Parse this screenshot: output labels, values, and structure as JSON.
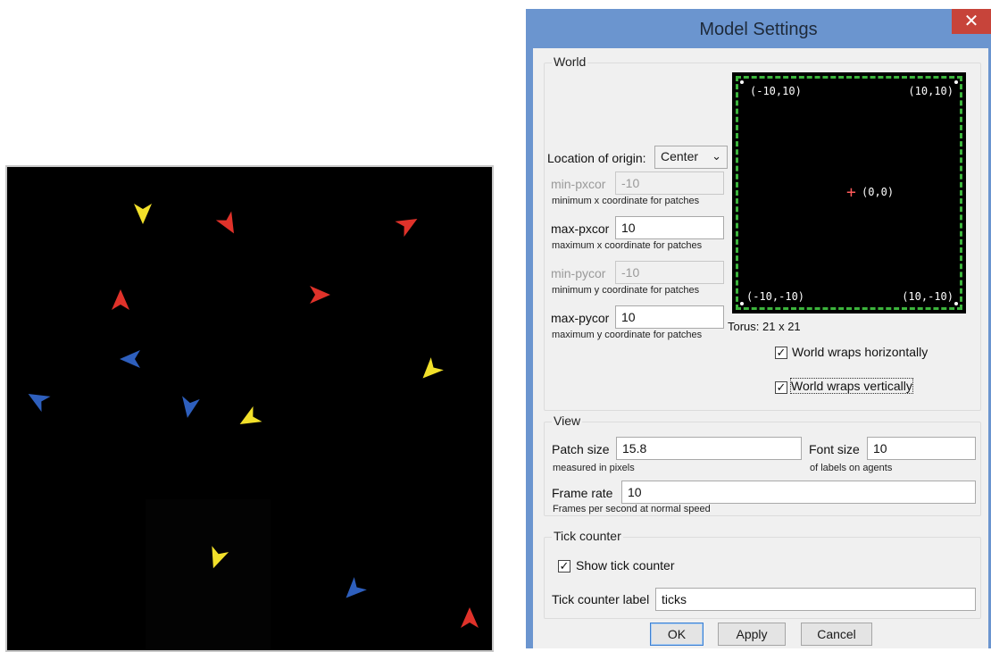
{
  "view": {
    "turtles": [
      {
        "color": "#f2e02a",
        "heading": 180
      },
      {
        "color": "#e0322a",
        "heading": 150
      },
      {
        "color": "#e0322a",
        "heading": 60
      },
      {
        "color": "#e0322a",
        "heading": 0
      },
      {
        "color": "#e0322a",
        "heading": 90
      },
      {
        "color": "#2e5fbd",
        "heading": 270
      },
      {
        "color": "#f2e02a",
        "heading": 225
      },
      {
        "color": "#2e5fbd",
        "heading": 300
      },
      {
        "color": "#2e5fbd",
        "heading": 190
      },
      {
        "color": "#f2e02a",
        "heading": 240
      },
      {
        "color": "#f2e02a",
        "heading": 200
      },
      {
        "color": "#2e5fbd",
        "heading": 225
      },
      {
        "color": "#e0322a",
        "heading": 0
      }
    ]
  },
  "dialog": {
    "title": "Model Settings",
    "close_glyph": "✕",
    "world": {
      "legend": "World",
      "origin_label": "Location of origin:",
      "origin_value": "Center",
      "min_pxcor_label": "min-pxcor",
      "min_pxcor_value": "-10",
      "min_pxcor_hint": "minimum x coordinate for patches",
      "max_pxcor_label": "max-pxcor",
      "max_pxcor_value": "10",
      "max_pxcor_hint": "maximum x coordinate for patches",
      "min_pycor_label": "min-pycor",
      "min_pycor_value": "-10",
      "min_pycor_hint": "minimum y coordinate for patches",
      "max_pycor_label": "max-pycor",
      "max_pycor_value": "10",
      "max_pycor_hint": "maximum y coordinate for patches",
      "preview": {
        "top_left": "(-10,10)",
        "top_right": "(10,10)",
        "center": "(0,0)",
        "bottom_left": "(-10,-10)",
        "bottom_right": "(10,-10)"
      },
      "torus_label": "Torus: 21 x 21",
      "wrap_h_label": "World wraps horizontally",
      "wrap_h_checked": true,
      "wrap_v_label": "World wraps vertically",
      "wrap_v_checked": true
    },
    "view": {
      "legend": "View",
      "patch_size_label": "Patch size",
      "patch_size_value": "15.8",
      "patch_size_hint": "measured in pixels",
      "font_size_label": "Font size",
      "font_size_value": "10",
      "font_size_hint": "of labels on agents",
      "frame_rate_label": "Frame rate",
      "frame_rate_value": "10",
      "frame_rate_hint": "Frames per second at normal speed"
    },
    "tick": {
      "legend": "Tick counter",
      "show_label": "Show tick counter",
      "show_checked": true,
      "label_label": "Tick counter label",
      "label_value": "ticks"
    },
    "buttons": {
      "ok": "OK",
      "apply": "Apply",
      "cancel": "Cancel"
    },
    "check_glyph": "✓"
  }
}
